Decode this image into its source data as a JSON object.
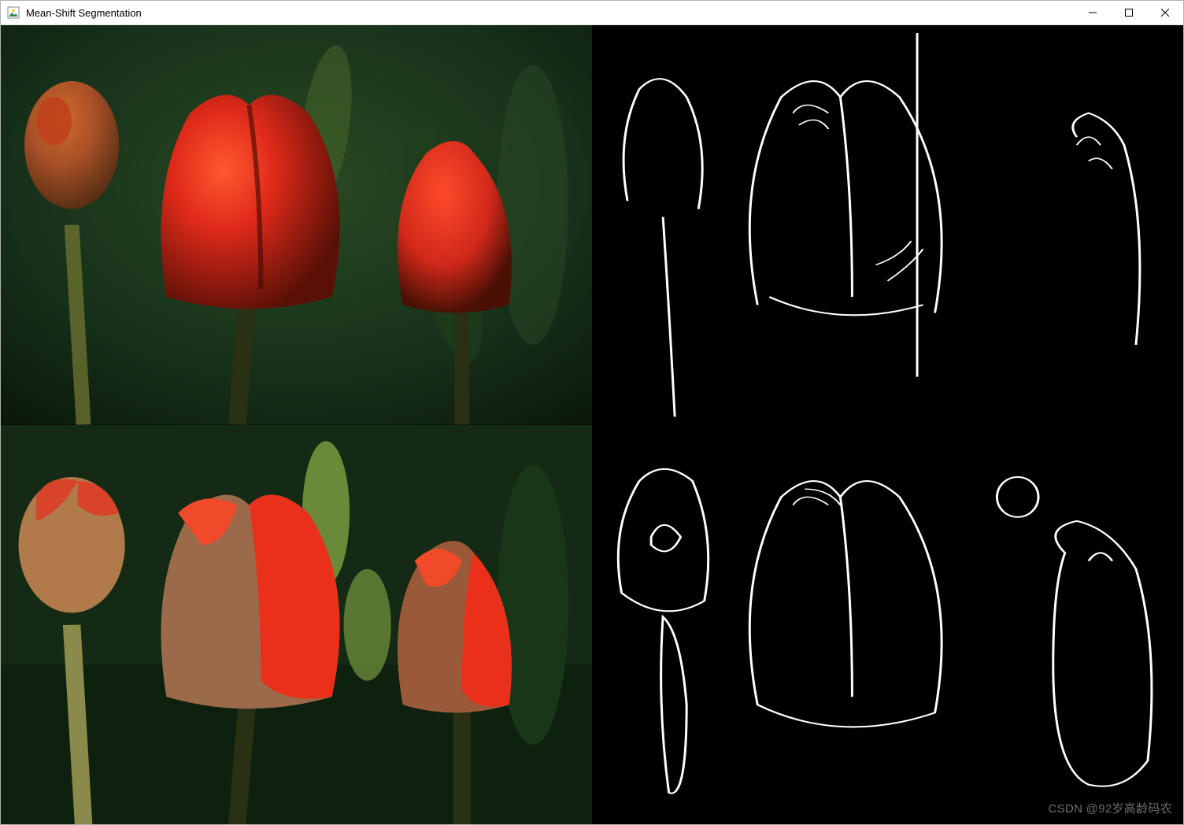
{
  "window": {
    "title": "Mean-Shift Segmentation"
  },
  "watermark": "CSDN @92岁高龄码农",
  "panels": {
    "top_left": "original-photo",
    "top_right": "edges-original",
    "bottom_left": "meanshift-result",
    "bottom_right": "edges-meanshift"
  },
  "colors": {
    "tulip_red": "#e02a1a",
    "tulip_dark": "#6a1508",
    "tulip_olive": "#8a8a3a",
    "leaf_dark": "#10210f",
    "leaf_mid": "#1e3a1c",
    "leaf_light": "#3a5a2a",
    "stem": "#2a3012",
    "edge": "#ffffff",
    "edge_bg": "#000000"
  }
}
